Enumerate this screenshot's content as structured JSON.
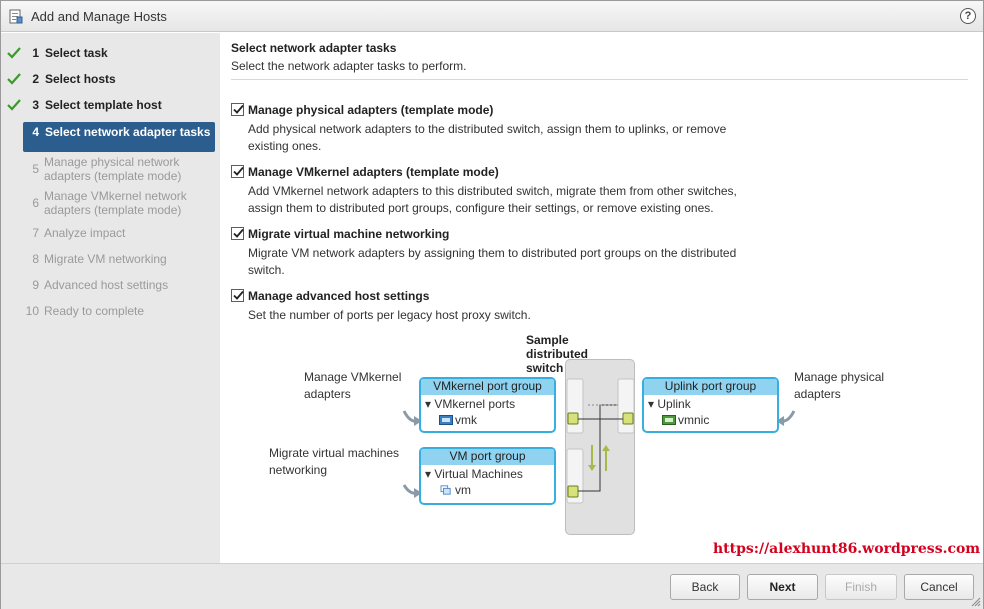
{
  "window": {
    "title": "Add and Manage Hosts",
    "help_glyph": "?"
  },
  "nav": {
    "steps": [
      {
        "num": "1",
        "label": "Select task",
        "state": "done"
      },
      {
        "num": "2",
        "label": "Select hosts",
        "state": "done"
      },
      {
        "num": "3",
        "label": "Select template host",
        "state": "done"
      },
      {
        "num": "4",
        "label": "Select network adapter tasks",
        "state": "active"
      },
      {
        "num": "5",
        "label": "Manage physical network adapters (template mode)",
        "state": "future"
      },
      {
        "num": "6",
        "label": "Manage VMkernel network adapters (template mode)",
        "state": "future"
      },
      {
        "num": "7",
        "label": "Analyze impact",
        "state": "future"
      },
      {
        "num": "8",
        "label": "Migrate VM networking",
        "state": "future"
      },
      {
        "num": "9",
        "label": "Advanced host settings",
        "state": "future"
      },
      {
        "num": "10",
        "label": "Ready to complete",
        "state": "future"
      }
    ]
  },
  "main": {
    "title": "Select network adapter tasks",
    "subtitle": "Select the network adapter tasks to perform.",
    "tasks": [
      {
        "title": "Manage physical adapters (template mode)",
        "desc": "Add physical network adapters to the distributed switch, assign them to uplinks, or remove existing ones.",
        "checked": true
      },
      {
        "title": "Manage VMkernel adapters (template mode)",
        "desc": "Add VMkernel network adapters to this distributed switch, migrate them from other switches, assign them to distributed port groups, configure their settings, or remove existing ones.",
        "checked": true
      },
      {
        "title": "Migrate virtual machine networking",
        "desc": "Migrate VM network adapters by assigning them to distributed port groups on the distributed switch.",
        "checked": true
      },
      {
        "title": "Manage advanced host settings",
        "desc": "Set the number of ports per legacy host proxy switch.",
        "checked": true
      }
    ]
  },
  "diagram": {
    "title": "Sample distributed switch",
    "label_vmkernel": "Manage VMkernel adapters",
    "label_vm": "Migrate virtual machines networking",
    "label_physical": "Manage physical adapters",
    "vmk_group": {
      "header": "VMkernel port group",
      "row": "VMkernel ports",
      "item": "vmk"
    },
    "vm_group": {
      "header": "VM port group",
      "row": "Virtual Machines",
      "item": "vm"
    },
    "uplink_group": {
      "header": "Uplink port group",
      "row": "Uplink",
      "item": "vmnic"
    }
  },
  "watermark": "https://alexhunt86.wordpress.com",
  "footer": {
    "back": "Back",
    "next": "Next",
    "finish": "Finish",
    "cancel": "Cancel"
  },
  "colors": {
    "accent": "#2b5d8e",
    "check": "#3a9a2a",
    "portgroup_border": "#36aee0",
    "portgroup_header": "#8fd3f0",
    "watermark": "#d4001e"
  }
}
